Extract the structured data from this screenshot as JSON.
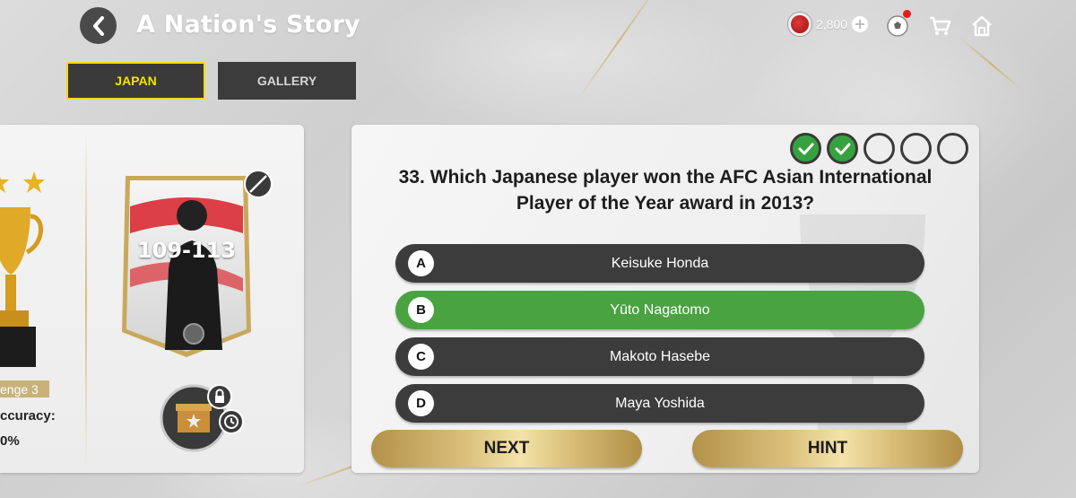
{
  "header": {
    "title": "A Nation's Story",
    "back_icon": "chevron-left-icon",
    "currency": {
      "amount": "2,800",
      "coin_color": "#d12a2a"
    }
  },
  "tabs": [
    {
      "label": "JAPAN",
      "active": true
    },
    {
      "label": "GALLERY",
      "active": false
    }
  ],
  "left_panel": {
    "challenge_label": "enge 3",
    "accuracy_label": "ccuracy:",
    "accuracy_value": "0%",
    "player_card": {
      "rating_range": "109-113"
    }
  },
  "quiz": {
    "progress": [
      "correct",
      "correct",
      "empty",
      "empty",
      "empty"
    ],
    "question": "33. Which Japanese player won the AFC Asian International Player of the Year award in 2013?",
    "answers": [
      {
        "letter": "A",
        "text": "Keisuke Honda",
        "state": "default"
      },
      {
        "letter": "B",
        "text": "Yūto Nagatomo",
        "state": "correct"
      },
      {
        "letter": "C",
        "text": "Makoto Hasebe",
        "state": "default"
      },
      {
        "letter": "D",
        "text": "Maya Yoshida",
        "state": "default"
      }
    ],
    "next_label": "NEXT",
    "hint_label": "HINT"
  },
  "colors": {
    "accent_yellow": "#f2e000",
    "correct_green": "#49a340",
    "gold": "#dbc07c"
  }
}
